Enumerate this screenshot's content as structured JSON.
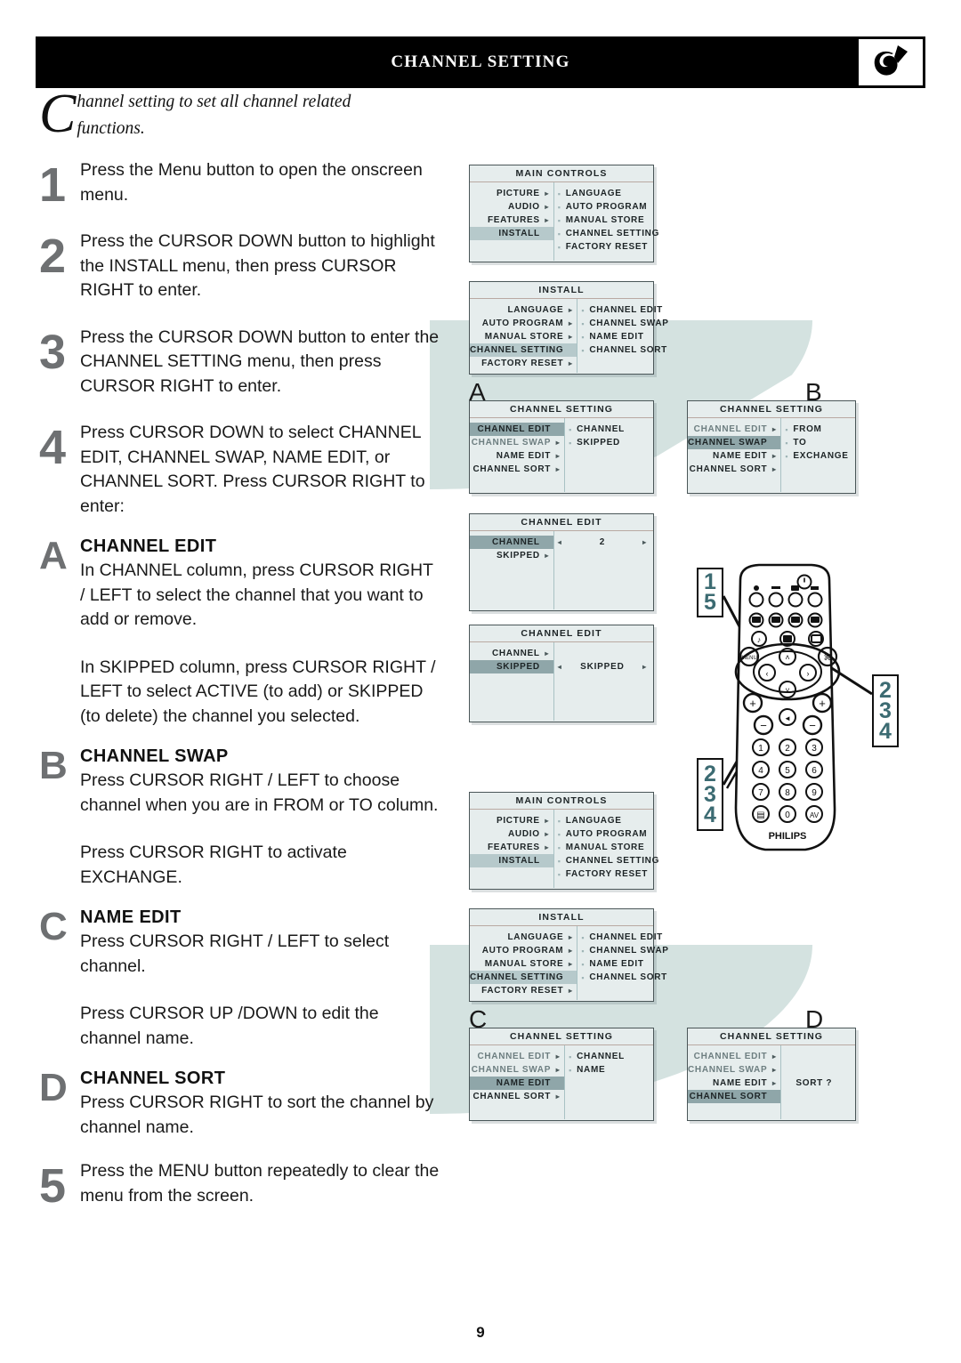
{
  "header": {
    "title": "Channel Setting",
    "logo_icon": "philips-shield-icon"
  },
  "intro": {
    "dropcap": "C",
    "text": "hannel setting to set all channel related functions."
  },
  "steps": [
    {
      "num": "1",
      "paragraphs": [
        "Press the Menu button to open the onscreen menu."
      ]
    },
    {
      "num": "2",
      "paragraphs": [
        "Press the CURSOR DOWN button to highlight the INSTALL menu, then press CURSOR RIGHT to enter."
      ]
    },
    {
      "num": "3",
      "paragraphs": [
        "Press the CURSOR DOWN button to enter the CHANNEL SETTING menu, then press CURSOR RIGHT to enter."
      ]
    },
    {
      "num": "4",
      "paragraphs": [
        "Press CURSOR DOWN to select CHANNEL EDIT, CHANNEL SWAP, NAME EDIT, or CHANNEL SORT. Press CURSOR RIGHT to enter:"
      ]
    }
  ],
  "sections": [
    {
      "letter": "A",
      "title": "CHANNEL EDIT",
      "paragraphs": [
        "In CHANNEL column, press CURSOR RIGHT / LEFT to select the channel that you want to add or remove.",
        "In SKIPPED column, press CURSOR RIGHT / LEFT to select ACTIVE (to add) or SKIPPED (to delete) the channel you selected."
      ]
    },
    {
      "letter": "B",
      "title": "CHANNEL SWAP",
      "paragraphs": [
        "Press CURSOR RIGHT / LEFT to choose channel when you are in FROM or TO column.",
        "Press CURSOR RIGHT to activate EXCHANGE."
      ]
    },
    {
      "letter": "C",
      "title": "NAME EDIT",
      "paragraphs": [
        "Press CURSOR RIGHT / LEFT to select channel.",
        "Press CURSOR UP /DOWN to edit the channel name."
      ]
    },
    {
      "letter": "D",
      "title": "CHANNEL SORT",
      "paragraphs": [
        "Press CURSOR RIGHT to sort the channel by channel name."
      ]
    }
  ],
  "final_step": {
    "num": "5",
    "paragraphs": [
      "Press the MENU button repeatedly to clear the menu from the screen."
    ]
  },
  "osd_menus": {
    "main_controls_1": {
      "title": "MAIN CONTROLS",
      "left_items": [
        {
          "label": "PICTURE",
          "arrow": true,
          "state": "normal"
        },
        {
          "label": "AUDIO",
          "arrow": true,
          "state": "normal"
        },
        {
          "label": "FEATURES",
          "arrow": true,
          "state": "normal"
        },
        {
          "label": "INSTALL",
          "arrow": false,
          "state": "highlight"
        }
      ],
      "right_items": [
        "LANGUAGE",
        "AUTO PROGRAM",
        "MANUAL STORE",
        "CHANNEL SETTING",
        "FACTORY RESET"
      ]
    },
    "install_1": {
      "title": "INSTALL",
      "left_items": [
        {
          "label": "LANGUAGE",
          "arrow": true,
          "state": "normal"
        },
        {
          "label": "AUTO PROGRAM",
          "arrow": true,
          "state": "normal"
        },
        {
          "label": "MANUAL STORE",
          "arrow": true,
          "state": "normal"
        },
        {
          "label": "CHANNEL SETTING",
          "arrow": false,
          "state": "highlight"
        },
        {
          "label": "FACTORY RESET",
          "arrow": true,
          "state": "normal"
        }
      ],
      "right_items": [
        "CHANNEL EDIT",
        "CHANNEL SWAP",
        "NAME EDIT",
        "CHANNEL SORT"
      ]
    },
    "channel_setting_a": {
      "letter": "A",
      "title": "CHANNEL SETTING",
      "left_items": [
        {
          "label": "CHANNEL EDIT",
          "arrow": false,
          "state": "highlight-dark"
        },
        {
          "label": "CHANNEL SWAP",
          "arrow": true,
          "state": "dim"
        },
        {
          "label": "NAME EDIT",
          "arrow": true,
          "state": "normal"
        },
        {
          "label": "CHANNEL SORT",
          "arrow": true,
          "state": "normal"
        }
      ],
      "right_items": [
        "CHANNEL",
        "SKIPPED"
      ]
    },
    "channel_setting_b": {
      "letter": "B",
      "title": "CHANNEL SETTING",
      "left_items": [
        {
          "label": "CHANNEL EDIT",
          "arrow": true,
          "state": "dim"
        },
        {
          "label": "CHANNEL SWAP",
          "arrow": false,
          "state": "highlight-dark"
        },
        {
          "label": "NAME EDIT",
          "arrow": true,
          "state": "normal"
        },
        {
          "label": "CHANNEL SORT",
          "arrow": true,
          "state": "normal"
        }
      ],
      "right_items": [
        "FROM",
        "TO",
        "EXCHANGE"
      ]
    },
    "channel_edit_channel": {
      "title": "CHANNEL EDIT",
      "left_items": [
        {
          "label": "CHANNEL",
          "arrow": false,
          "state": "highlight-dark"
        },
        {
          "label": "SKIPPED",
          "arrow": true,
          "state": "normal"
        }
      ],
      "value_row": 0,
      "value": "2",
      "arrow_left": "◂",
      "arrow_right": "▸"
    },
    "channel_edit_skipped": {
      "title": "CHANNEL EDIT",
      "left_items": [
        {
          "label": "CHANNEL",
          "arrow": true,
          "state": "normal"
        },
        {
          "label": "SKIPPED",
          "arrow": false,
          "state": "highlight-dark"
        }
      ],
      "value_row": 1,
      "value": "SKIPPED",
      "arrow_left": "◂",
      "arrow_right": "▸"
    },
    "main_controls_2": {
      "title": "MAIN CONTROLS",
      "left_items": [
        {
          "label": "PICTURE",
          "arrow": true,
          "state": "normal"
        },
        {
          "label": "AUDIO",
          "arrow": true,
          "state": "normal"
        },
        {
          "label": "FEATURES",
          "arrow": true,
          "state": "normal"
        },
        {
          "label": "INSTALL",
          "arrow": false,
          "state": "highlight"
        }
      ],
      "right_items": [
        "LANGUAGE",
        "AUTO PROGRAM",
        "MANUAL STORE",
        "CHANNEL SETTING",
        "FACTORY RESET"
      ]
    },
    "install_2": {
      "title": "INSTALL",
      "left_items": [
        {
          "label": "LANGUAGE",
          "arrow": true,
          "state": "normal"
        },
        {
          "label": "AUTO PROGRAM",
          "arrow": true,
          "state": "normal"
        },
        {
          "label": "MANUAL STORE",
          "arrow": true,
          "state": "normal"
        },
        {
          "label": "CHANNEL SETTING",
          "arrow": false,
          "state": "highlight"
        },
        {
          "label": "FACTORY RESET",
          "arrow": true,
          "state": "normal"
        }
      ],
      "right_items": [
        "CHANNEL EDIT",
        "CHANNEL SWAP",
        "NAME EDIT",
        "CHANNEL SORT"
      ]
    },
    "channel_setting_c": {
      "letter": "C",
      "title": "CHANNEL SETTING",
      "left_items": [
        {
          "label": "CHANNEL EDIT",
          "arrow": true,
          "state": "dim"
        },
        {
          "label": "CHANNEL SWAP",
          "arrow": true,
          "state": "dim"
        },
        {
          "label": "NAME EDIT",
          "arrow": false,
          "state": "highlight-dark"
        },
        {
          "label": "CHANNEL SORT",
          "arrow": true,
          "state": "normal"
        }
      ],
      "right_items": [
        "CHANNEL",
        "NAME"
      ]
    },
    "channel_setting_d": {
      "letter": "D",
      "title": "CHANNEL SETTING",
      "left_items": [
        {
          "label": "CHANNEL EDIT",
          "arrow": true,
          "state": "dim"
        },
        {
          "label": "CHANNEL SWAP",
          "arrow": true,
          "state": "dim"
        },
        {
          "label": "NAME EDIT",
          "arrow": true,
          "state": "normal"
        },
        {
          "label": "CHANNEL SORT",
          "arrow": false,
          "state": "highlight-dark"
        }
      ],
      "right_items": [],
      "sort_prompt": "SORT ?"
    }
  },
  "remote": {
    "brand": "PHILIPS",
    "callout_menu": [
      "1",
      "5"
    ],
    "callout_cursor_right": [
      "2",
      "3",
      "4"
    ],
    "callout_cursor_down": [
      "2",
      "3",
      "4"
    ],
    "menu_button_label": "MENU",
    "number_keys": [
      "1",
      "2",
      "3",
      "4",
      "5",
      "6",
      "7",
      "8",
      "9",
      "0"
    ],
    "av_key": "AV"
  },
  "footer": {
    "page_number": "9"
  },
  "colors": {
    "header_bg": "#000000",
    "osd_bg": "#e6eded",
    "osd_highlight": "#b6c9cb",
    "osd_highlight_dark": "#8fa6a9",
    "teal_accent": "#d4e2e0",
    "callout_text": "#3c6b72",
    "step_number": "#6e7072"
  }
}
